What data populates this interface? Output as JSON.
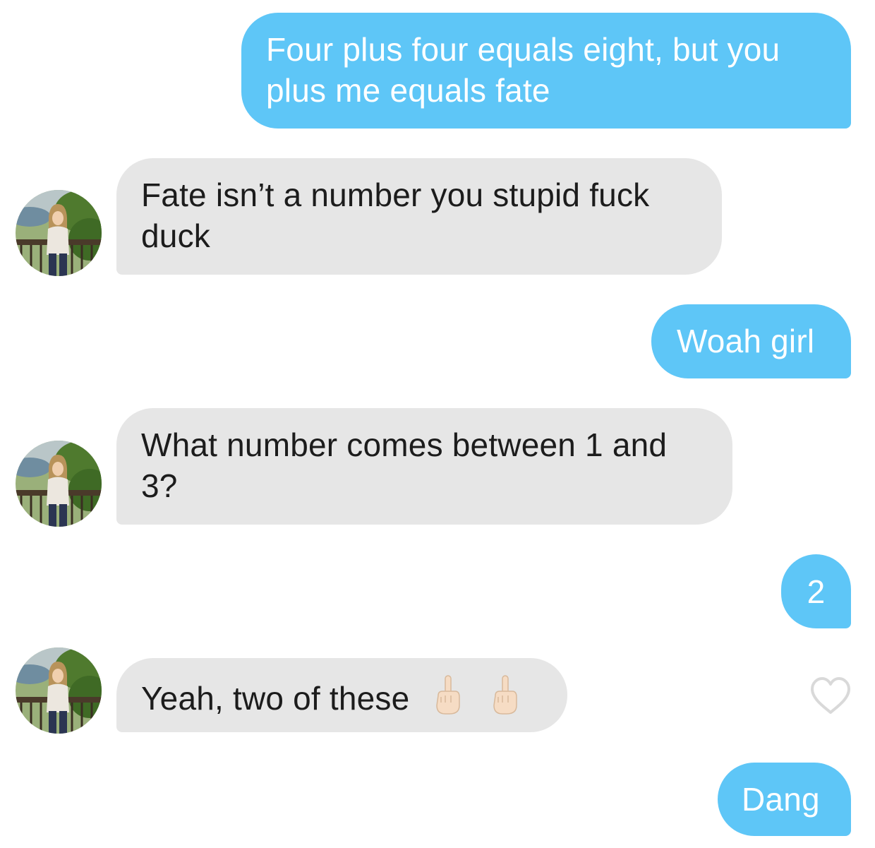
{
  "messages": [
    {
      "from": "me",
      "text": "Four plus four equals eight, but you plus me equals fate"
    },
    {
      "from": "them",
      "text": "Fate isn’t a number you stupid fuck duck"
    },
    {
      "from": "me",
      "text": "Woah girl"
    },
    {
      "from": "them",
      "text": "What number comes between 1 and 3?"
    },
    {
      "from": "me",
      "text": "2"
    },
    {
      "from": "them",
      "text": "Yeah, two of these",
      "emoji": [
        "middle-finger-emoji",
        "middle-finger-emoji"
      ]
    },
    {
      "from": "me",
      "text": "Dang"
    }
  ],
  "icons": {
    "like": "heart-icon",
    "avatar": "avatar"
  },
  "colors": {
    "sent_bubble": "#5ec6f7",
    "received_bubble": "#e6e6e6",
    "sent_text": "#ffffff",
    "received_text": "#1c1c1c",
    "heart_outline": "#d9d9d9"
  }
}
